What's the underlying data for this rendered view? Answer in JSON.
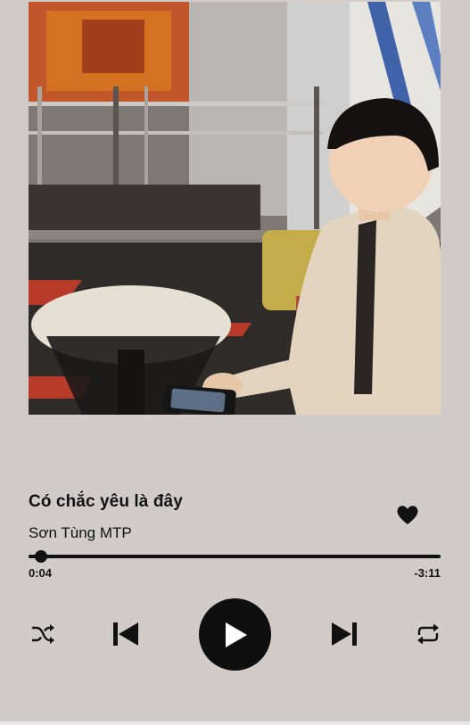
{
  "track": {
    "title": "Có chắc yêu là đây",
    "artist": "Sơn Tùng MTP",
    "liked": true
  },
  "playback": {
    "elapsed": "0:04",
    "remaining": "-3:11",
    "progress_fraction": 0.03,
    "state": "paused"
  },
  "icons": {
    "like": "heart-icon",
    "shuffle": "shuffle-icon",
    "previous": "skip-previous-icon",
    "play": "play-icon",
    "next": "skip-next-icon",
    "repeat": "repeat-icon"
  },
  "colors": {
    "background": "#d1ccca",
    "foreground": "#111111"
  }
}
